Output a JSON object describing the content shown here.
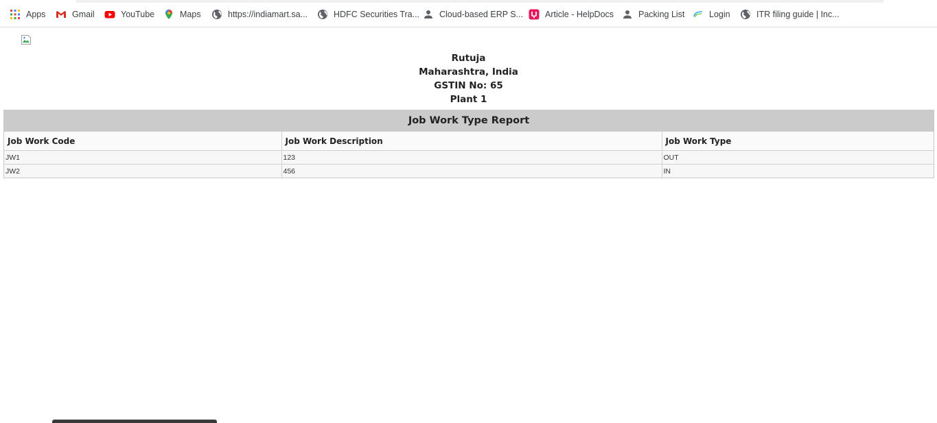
{
  "bookmarks": [
    {
      "label": "Apps",
      "icon": "apps-grid-icon"
    },
    {
      "label": "Gmail",
      "icon": "gmail-icon"
    },
    {
      "label": "YouTube",
      "icon": "youtube-icon"
    },
    {
      "label": "Maps",
      "icon": "maps-pin-icon"
    },
    {
      "label": "https://indiamart.sa...",
      "icon": "globe-icon"
    },
    {
      "label": "HDFC Securities Tra...",
      "icon": "globe-icon"
    },
    {
      "label": "Cloud-based ERP S...",
      "icon": "person-icon"
    },
    {
      "label": "Article - HelpDocs",
      "icon": "helpdocs-icon"
    },
    {
      "label": "Packing List",
      "icon": "person-icon"
    },
    {
      "label": "Login",
      "icon": "login-logo-icon"
    },
    {
      "label": "ITR filing guide | Inc...",
      "icon": "globe-icon"
    }
  ],
  "company": {
    "name": "Rutuja",
    "location": "Maharashtra, India",
    "gstin": "GSTIN No: 65",
    "plant": "Plant 1"
  },
  "report": {
    "title": "Job Work Type Report",
    "columns": [
      "Job Work Code",
      "Job Work Description",
      "Job Work Type"
    ],
    "rows": [
      [
        "JW1",
        "123",
        "OUT"
      ],
      [
        "JW2",
        "456",
        "IN"
      ]
    ]
  },
  "colors": {
    "title_bar": "#cbcbcb",
    "youtube_red": "#ff0000",
    "gmail_red": "#d93025",
    "helpdocs_pink": "#e8185e"
  }
}
